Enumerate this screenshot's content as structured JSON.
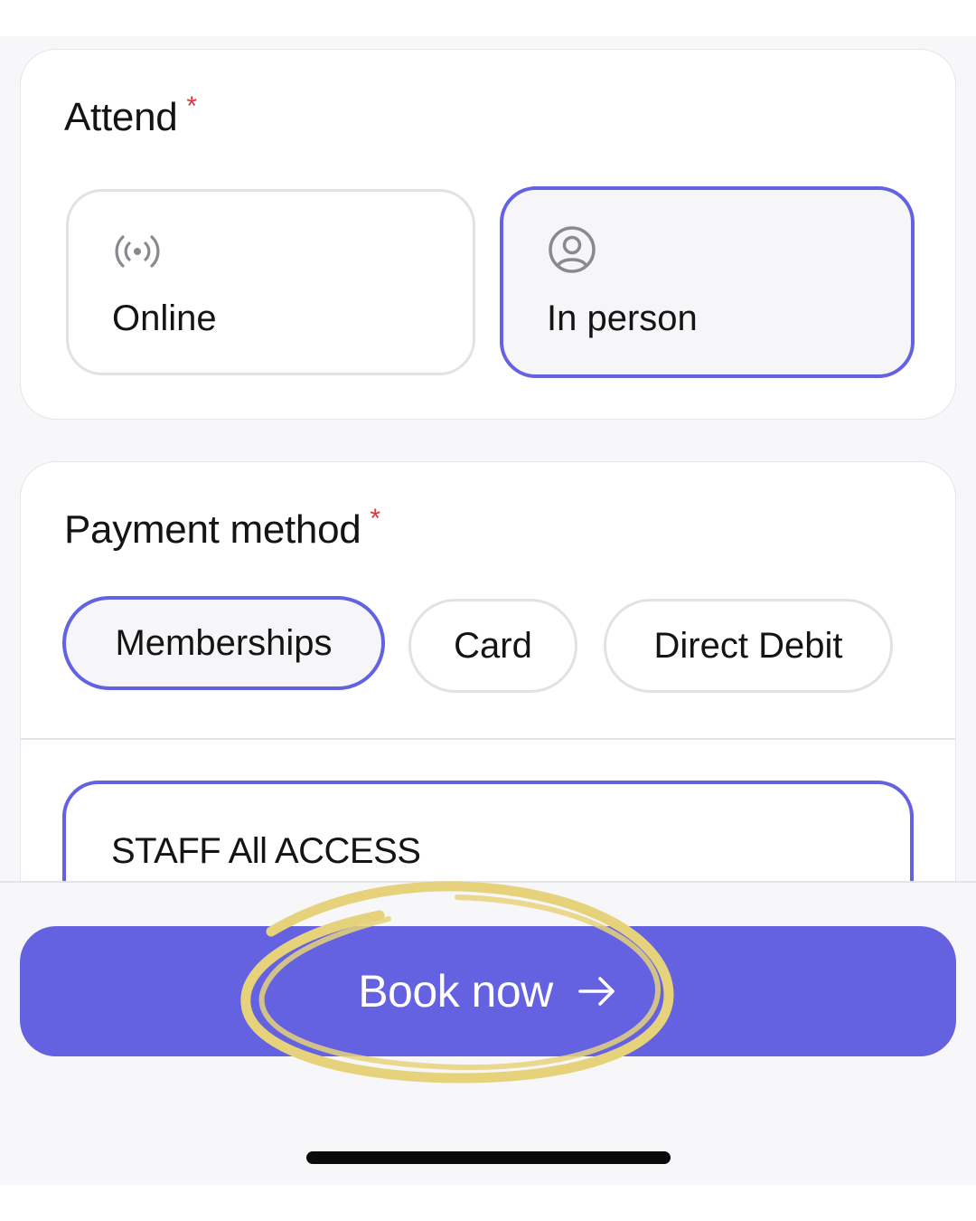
{
  "attend": {
    "title": "Attend",
    "required_mark": "*",
    "options": [
      {
        "label": "Online",
        "icon": "broadcast-icon",
        "selected": false
      },
      {
        "label": "In person",
        "icon": "user-circle-icon",
        "selected": true
      }
    ]
  },
  "payment": {
    "title": "Payment method",
    "required_mark": "*",
    "options": [
      {
        "label": "Memberships",
        "selected": true
      },
      {
        "label": "Card",
        "selected": false
      },
      {
        "label": "Direct Debit",
        "selected": false
      }
    ],
    "membership": {
      "name": "STAFF All ACCESS"
    }
  },
  "footer": {
    "book_label": "Book now",
    "book_icon": "arrow-right-icon"
  },
  "colors": {
    "accent": "#6462e0",
    "required": "#e0343c",
    "highlight": "#e6d27a"
  }
}
